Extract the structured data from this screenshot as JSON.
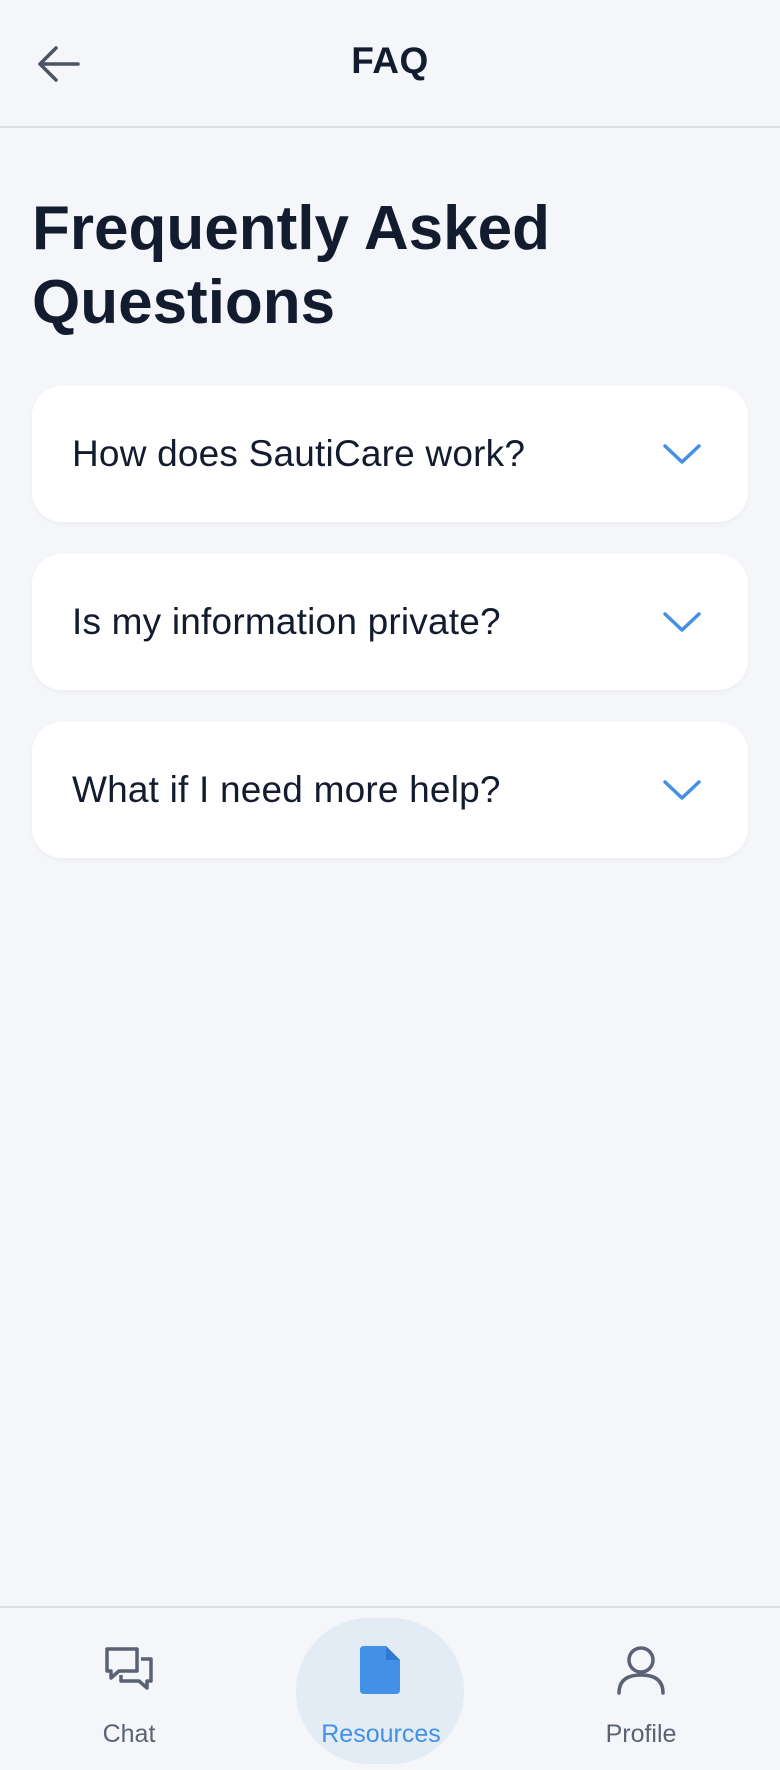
{
  "header": {
    "title": "FAQ",
    "back_icon": "arrow-left-icon"
  },
  "page": {
    "title": "Frequently Asked Questions"
  },
  "faq": {
    "items": [
      {
        "question": "How does SautiCare work?",
        "icon": "chevron-down-icon"
      },
      {
        "question": "Is my information private?",
        "icon": "chevron-down-icon"
      },
      {
        "question": "What if I need more help?",
        "icon": "chevron-down-icon"
      }
    ]
  },
  "nav": {
    "items": [
      {
        "label": "Chat",
        "icon": "chat-bubbles-icon",
        "active": false
      },
      {
        "label": "Resources",
        "icon": "document-icon",
        "active": true
      },
      {
        "label": "Profile",
        "icon": "user-icon",
        "active": false
      }
    ]
  },
  "colors": {
    "background": "#f4f6f9",
    "text": "#131b2e",
    "accent": "#4291e6",
    "active_pill": "#e3ebf5",
    "muted": "#5a6273"
  }
}
